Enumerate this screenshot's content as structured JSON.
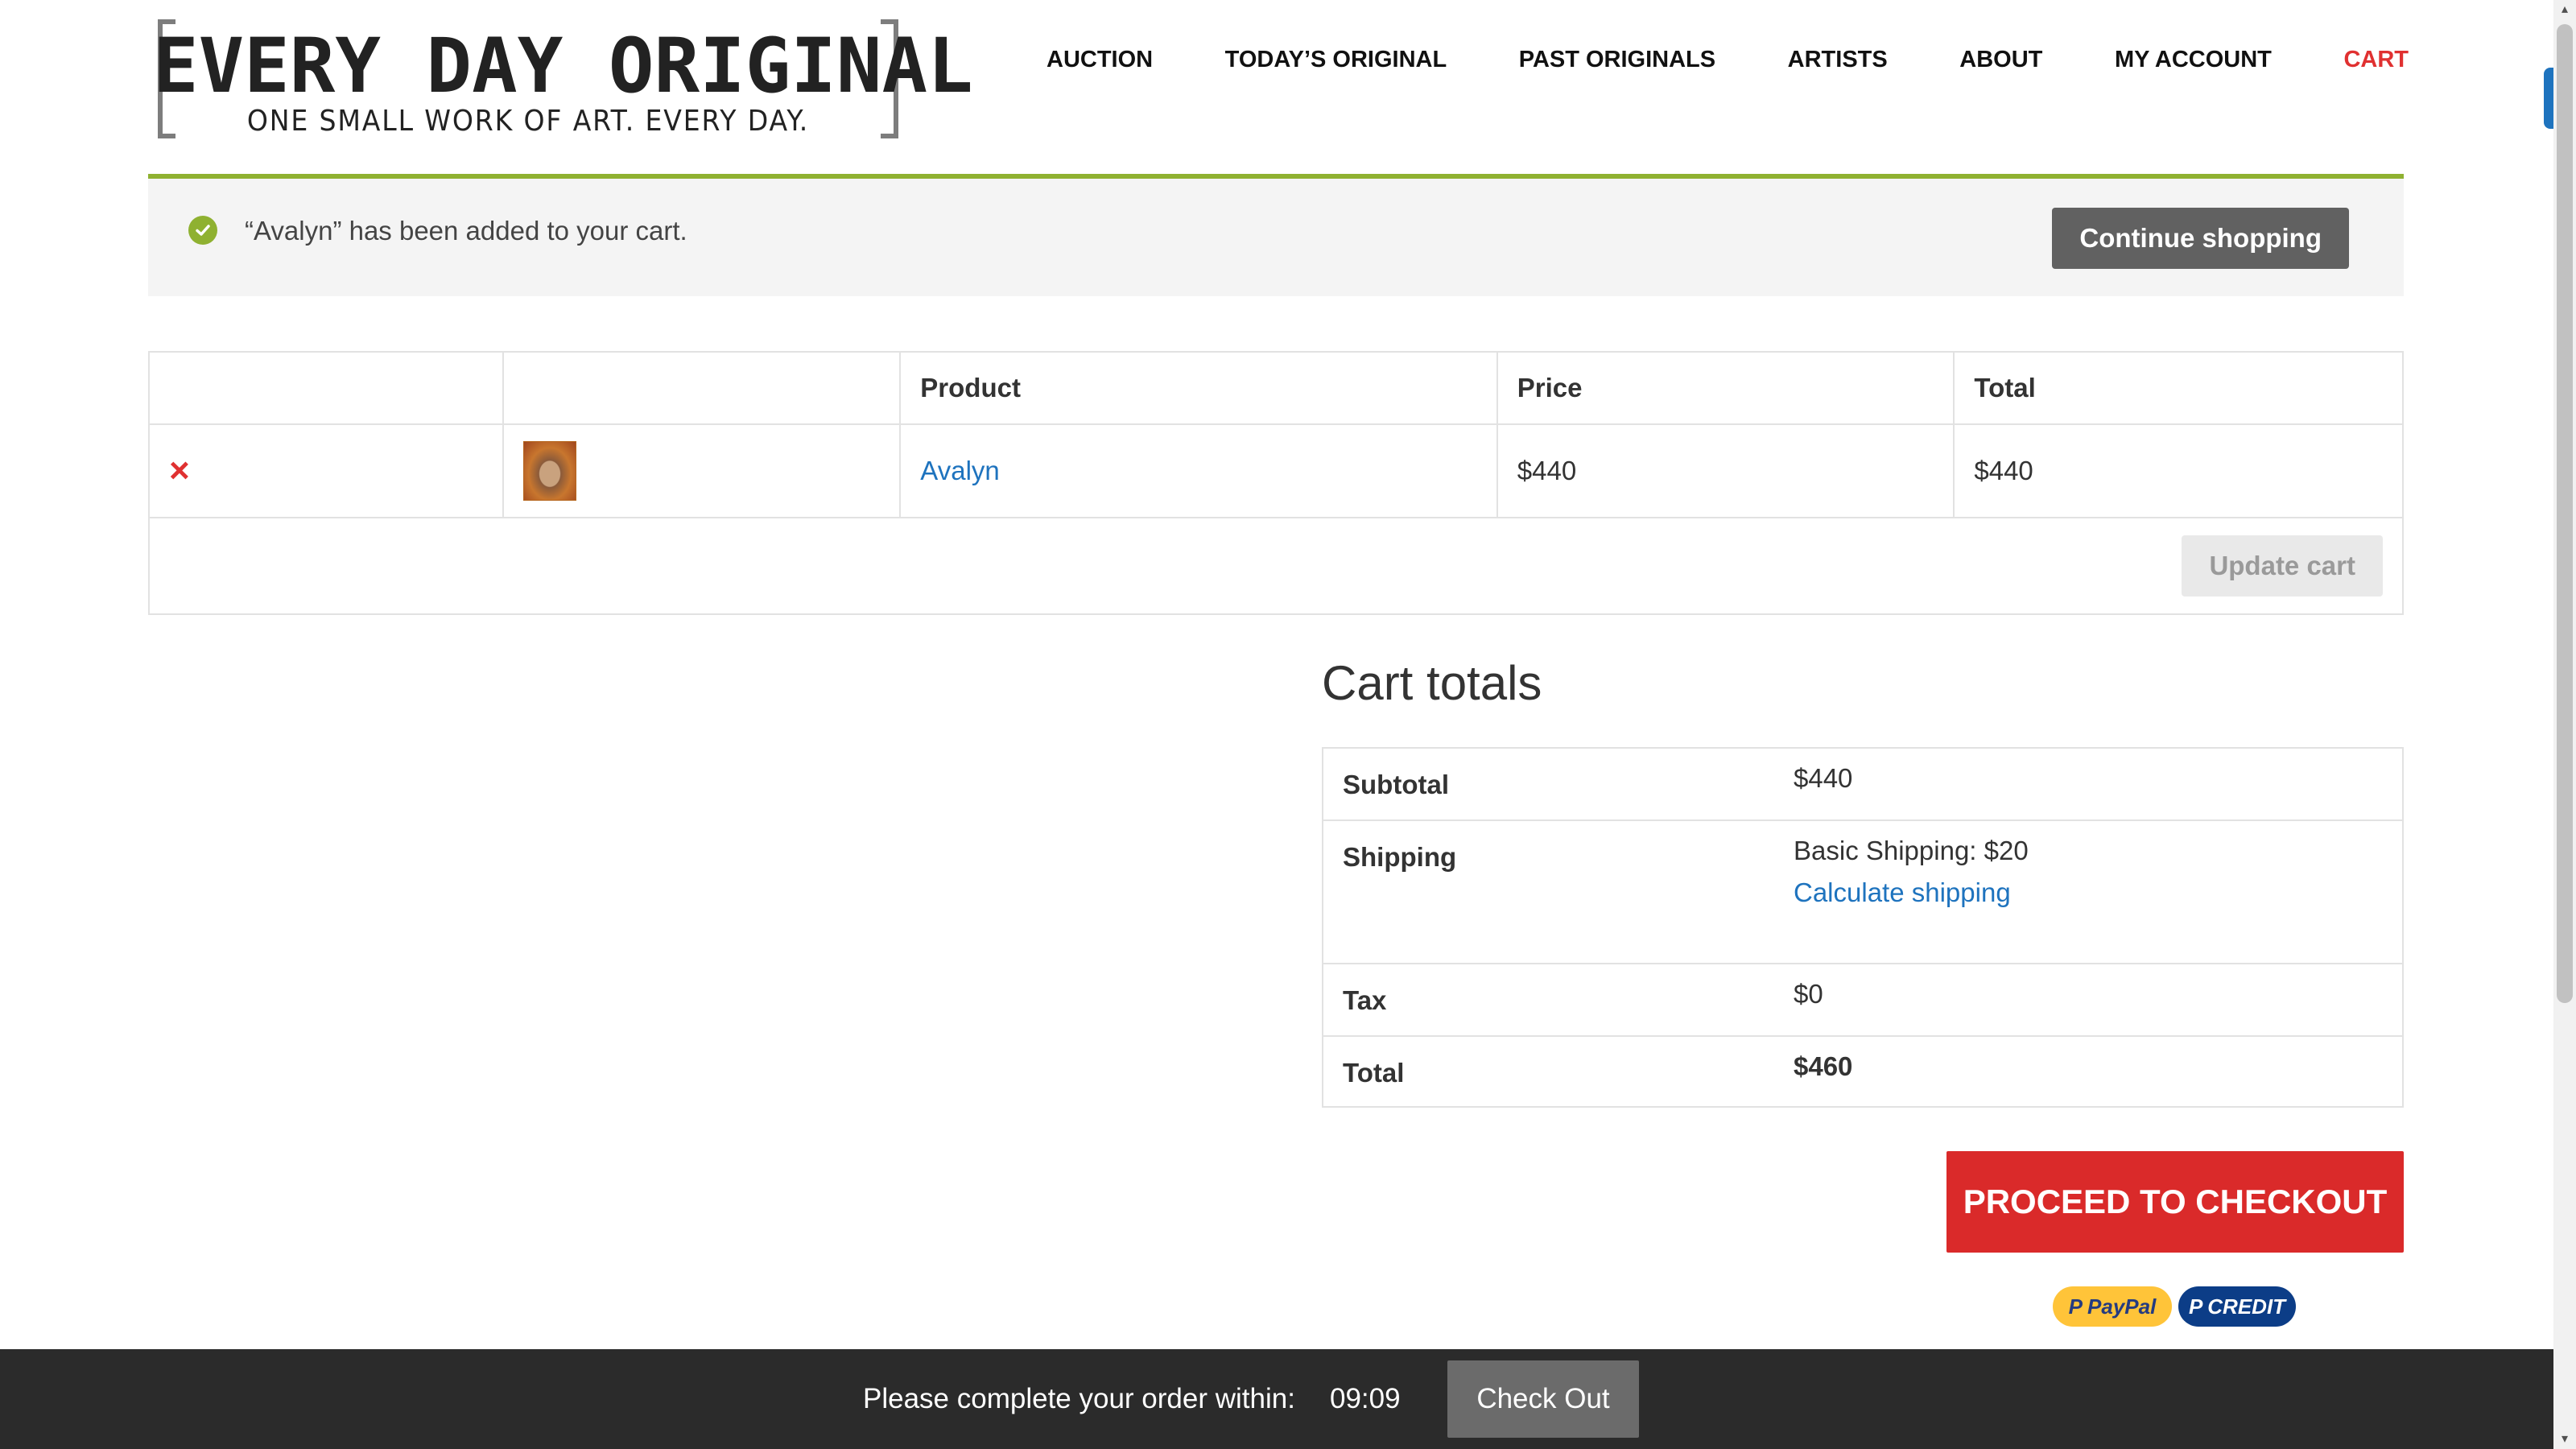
{
  "header": {
    "logo_title": "EVERY DAY ORIGINAL",
    "logo_tagline": "ONE SMALL WORK OF ART. EVERY DAY.",
    "nav": [
      "AUCTION",
      "TODAY’S ORIGINAL",
      "PAST ORIGINALS",
      "ARTISTS",
      "ABOUT",
      "MY ACCOUNT",
      "CART"
    ]
  },
  "notice": {
    "message": "“Avalyn” has been added to your cart.",
    "continue_label": "Continue shopping"
  },
  "cart": {
    "headers": {
      "product": "Product",
      "price": "Price",
      "total": "Total"
    },
    "items": [
      {
        "name": "Avalyn",
        "price": "$440",
        "total": "$440"
      }
    ],
    "remove_symbol": "×",
    "update_label": "Update cart"
  },
  "totals": {
    "title": "Cart totals",
    "subtotal_label": "Subtotal",
    "subtotal_value": "$440",
    "shipping_label": "Shipping",
    "shipping_value": "Basic Shipping: $20",
    "calculate_label": "Calculate shipping",
    "tax_label": "Tax",
    "tax_value": "$0",
    "total_label": "Total",
    "total_value": "$460",
    "checkout_label": "Proceed to checkout",
    "paypal_label": "PayPal",
    "credit_label": "CREDIT"
  },
  "bar": {
    "prompt": "Please complete your order within:",
    "timer": "09:09",
    "checkout_label": "Check Out"
  },
  "colors": {
    "accent_red": "#da2a2a",
    "success_green": "#8fb131",
    "link_blue": "#1e73be",
    "dark_bar": "#2b2b2b"
  }
}
